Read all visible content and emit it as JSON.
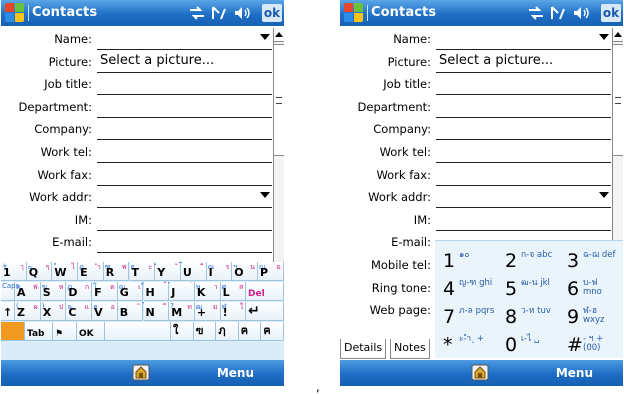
{
  "titlebar": {
    "title": "Contacts",
    "ok_label": "ok"
  },
  "fields_left": [
    {
      "label": "Name:",
      "value": "",
      "dropdown": true
    },
    {
      "label": "Picture:",
      "value": "Select a picture...",
      "dropdown": false
    },
    {
      "label": "Job title:",
      "value": "",
      "dropdown": false
    },
    {
      "label": "Department:",
      "value": "",
      "dropdown": false
    },
    {
      "label": "Company:",
      "value": "",
      "dropdown": false
    },
    {
      "label": "Work tel:",
      "value": "",
      "dropdown": false
    },
    {
      "label": "Work fax:",
      "value": "",
      "dropdown": false
    },
    {
      "label": "Work addr:",
      "value": "",
      "dropdown": true
    },
    {
      "label": "IM:",
      "value": "",
      "dropdown": false
    },
    {
      "label": "E-mail:",
      "value": "",
      "dropdown": false
    }
  ],
  "fields_right": [
    {
      "label": "Name:",
      "value": "",
      "dropdown": true
    },
    {
      "label": "Picture:",
      "value": "Select a picture...",
      "dropdown": false
    },
    {
      "label": "Job title:",
      "value": "",
      "dropdown": false
    },
    {
      "label": "Department:",
      "value": "",
      "dropdown": false
    },
    {
      "label": "Company:",
      "value": "",
      "dropdown": false
    },
    {
      "label": "Work tel:",
      "value": "",
      "dropdown": false
    },
    {
      "label": "Work fax:",
      "value": "",
      "dropdown": false
    },
    {
      "label": "Work addr:",
      "value": "",
      "dropdown": true
    },
    {
      "label": "IM:",
      "value": "",
      "dropdown": false
    },
    {
      "label": "E-mail:",
      "value": "",
      "dropdown": false
    },
    {
      "label": "Mobile tel:",
      "value": "",
      "dropdown": false
    },
    {
      "label": "Ring tone:",
      "value": "",
      "dropdown": false
    },
    {
      "label": "Web page:",
      "value": "",
      "dropdown": false
    }
  ],
  "keyboard": {
    "row1": [
      {
        "m": "1",
        "t": "ๅ",
        "t2": "+"
      },
      {
        "m": "Q",
        "t": "ๆ",
        "t2": "๐"
      },
      {
        "m": "W",
        "t": "ไ",
        "t2": "\""
      },
      {
        "m": "E",
        "t": "ำ",
        "t2": "ฎ"
      },
      {
        "m": "R",
        "t": "พ",
        "t2": "ฑ"
      },
      {
        "m": "T",
        "t": "ะ",
        "t2": "ธ"
      },
      {
        "m": "Y",
        "t": "ั",
        "t2": "ํ"
      },
      {
        "m": "U",
        "t": "ี",
        "t2": "๊"
      },
      {
        "m": "I",
        "t": "ร",
        "t2": "ณ"
      },
      {
        "m": "O",
        "t": "น",
        "t2": "ฯ"
      },
      {
        "m": "P",
        "t": "ย",
        "t2": "ญ"
      }
    ],
    "row2": [
      {
        "m": "A",
        "t": "ฟ",
        "t2": "ฤ"
      },
      {
        "m": "S",
        "t": "ห",
        "t2": "ฆ"
      },
      {
        "m": "D",
        "t": "ก",
        "t2": "ฏ"
      },
      {
        "m": "F",
        "t": "ด",
        "t2": "โ"
      },
      {
        "m": "G",
        "t": "เ",
        "t2": "ฌ"
      },
      {
        "m": "H",
        "t": "้",
        "t2": "็"
      },
      {
        "m": "J",
        "t": "่",
        "t2": "๋"
      },
      {
        "m": "K",
        "t": "า",
        "t2": "ษ"
      },
      {
        "m": "L",
        "t": "ส",
        "t2": "ศ"
      }
    ],
    "row3": [
      {
        "m": "Z",
        "t": "ผ",
        "t2": "("
      },
      {
        "m": "X",
        "t": "ป",
        "t2": ")"
      },
      {
        "m": "C",
        "t": "แ",
        "t2": "ฉ"
      },
      {
        "m": "V",
        "t": "อ",
        "t2": "ฮ"
      },
      {
        "m": "B",
        "t": "ิ",
        "t2": "ฺ"
      },
      {
        "m": "N",
        "t": "ื",
        "t2": "์"
      },
      {
        "m": "M",
        "t": "ท",
        "t2": "?"
      },
      {
        "m": "+",
        "t": "ม",
        "t2": "ฒ"
      },
      {
        "m": "!",
        "t": "ใ",
        "t2": "ฬ"
      }
    ],
    "del_label": "Del",
    "caps_label": "Caps",
    "tab_label": "Tab",
    "ok_label": "OK",
    "bottom_thai": [
      "ใ",
      "ฃ",
      "ฦ",
      "ฅ",
      "ฅ"
    ]
  },
  "numpad": [
    {
      "d": "1",
      "a": "๑๐"
    },
    {
      "d": "2",
      "a": "ก-จ abc"
    },
    {
      "d": "3",
      "a": "ฉ-ฌ def"
    },
    {
      "d": "4",
      "a": "ญ-ฑ ghi"
    },
    {
      "d": "5",
      "a": "ฒ-น jkl"
    },
    {
      "d": "6",
      "a": "บ-ฟ mno"
    },
    {
      "d": "7",
      "a": "ภ-ล pqrs"
    },
    {
      "d": "8",
      "a": "ว-ห tuv"
    },
    {
      "d": "9",
      "a": "ฬ-ฮ wxyz"
    },
    {
      "d": "*",
      "a": "ะ-ำ ุ +"
    },
    {
      "d": "0",
      "a": "เ-ไ ␣"
    },
    {
      "d": "#",
      "a": "- ฯ +(00)"
    }
  ],
  "tabs": [
    "Details",
    "Notes"
  ],
  "bottombar": {
    "menu_label": "Menu"
  },
  "colors": {
    "titlebar": "#1f6fc6",
    "keyboard": "#d9ecf7",
    "accent_thai": "#d0208a"
  },
  "icons": [
    "windows-start-icon",
    "connectivity-icon",
    "signal-icon",
    "volume-icon",
    "keyboard-input-icon"
  ]
}
